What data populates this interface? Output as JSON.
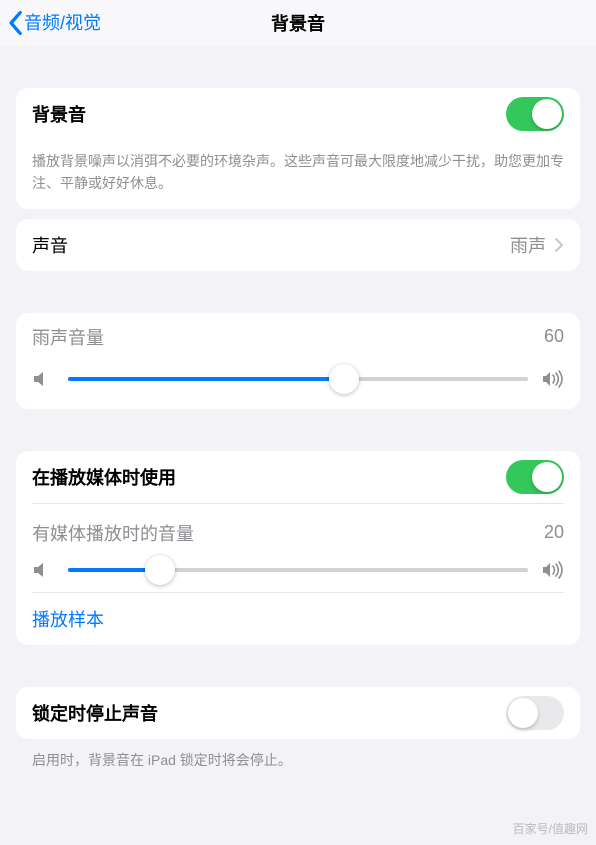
{
  "header": {
    "back_label": "音频/视觉",
    "title": "背景音"
  },
  "section1": {
    "label": "背景音",
    "enabled": true,
    "footer": "播放背景噪声以消弭不必要的环境杂声。这些声音可最大限度地减少干扰，助您更加专注、平静或好好休息。"
  },
  "sound_row": {
    "label": "声音",
    "value": "雨声"
  },
  "volume1": {
    "label": "雨声音量",
    "value": 60,
    "percent": 60
  },
  "section3": {
    "media_label": "在播放媒体时使用",
    "media_enabled": true,
    "vol_label": "有媒体播放时的音量",
    "vol_value": 20,
    "vol_percent": 20,
    "play_sample": "播放样本"
  },
  "section4": {
    "label": "锁定时停止声音",
    "enabled": false,
    "footer": "启用时，背景音在 iPad 锁定时将会停止。"
  },
  "watermark": "百家号/值趣网"
}
